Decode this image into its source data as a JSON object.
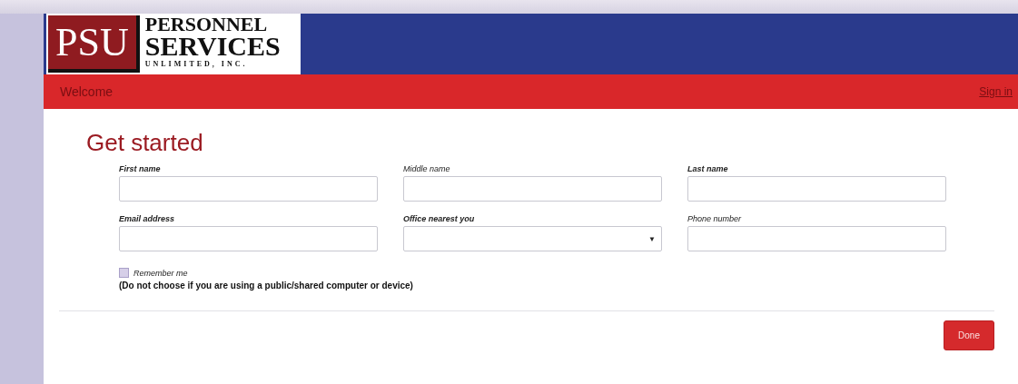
{
  "logo": {
    "mark": "PSU",
    "line_1": "PERSONNEL",
    "line_2": "SERVICES",
    "line_3": "UNLIMITED, INC."
  },
  "nav": {
    "title": "Welcome",
    "link": "Sign in"
  },
  "heading": "Get started",
  "fields": [
    {
      "label": "First name",
      "bold": true,
      "kind": "text"
    },
    {
      "label": "Middle name",
      "bold": false,
      "kind": "text"
    },
    {
      "label": "Last name",
      "bold": true,
      "kind": "text"
    },
    {
      "label": "Email address",
      "bold": true,
      "kind": "text"
    },
    {
      "label": "Office nearest you",
      "bold": true,
      "kind": "select",
      "caret": "▼"
    },
    {
      "label": "Phone number",
      "bold": false,
      "kind": "text"
    }
  ],
  "remember": {
    "label": "Remember me",
    "checked": false,
    "note": "(Do not choose if you are using a public/shared computer or device)"
  },
  "buttons": [
    "Done"
  ]
}
